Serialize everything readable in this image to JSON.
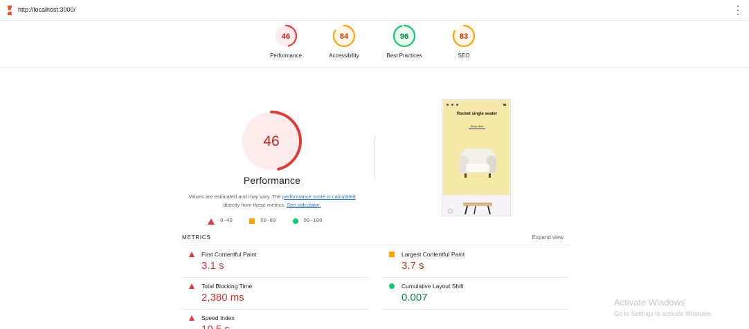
{
  "url": "http://localhost:3000/",
  "colors": {
    "fail": "#d93025",
    "average": "#c33300",
    "pass": "#018642",
    "fail_ring": "#e53935",
    "average_ring": "#ffa400",
    "pass_ring": "#0cce6b"
  },
  "gauges": [
    {
      "score": "46",
      "label": "Performance",
      "status": "fail"
    },
    {
      "score": "84",
      "label": "Accessibility",
      "status": "average"
    },
    {
      "score": "96",
      "label": "Best Practices",
      "status": "pass"
    },
    {
      "score": "83",
      "label": "SEO",
      "status": "average"
    }
  ],
  "performance": {
    "score": "46",
    "title": "Performance",
    "desc_prefix": "Values are estimated and may vary. The ",
    "desc_link1": "performance score is calculated",
    "desc_middle": " directly from these metrics. ",
    "desc_link2": "See calculator."
  },
  "legend": [
    {
      "icon": "triangle-icon",
      "range": "0–49"
    },
    {
      "icon": "square-icon",
      "range": "50–89"
    },
    {
      "icon": "circle-icon",
      "range": "90–100"
    }
  ],
  "preview": {
    "heading": "Rocket single seater",
    "link": "Shop Now"
  },
  "metrics": {
    "title": "METRICS",
    "expand": "Expand view",
    "items": [
      {
        "label": "First Contentful Paint",
        "value": "3.1 s",
        "status": "fail"
      },
      {
        "label": "Largest Contentful Paint",
        "value": "3.7 s",
        "status": "average"
      },
      {
        "label": "Total Blocking Time",
        "value": "2,380 ms",
        "status": "fail"
      },
      {
        "label": "Cumulative Layout Shift",
        "value": "0.007",
        "status": "pass"
      },
      {
        "label": "Speed Index",
        "value": "10.5 s",
        "status": "fail"
      }
    ]
  },
  "watermark": {
    "line1": "Activate Windows",
    "line2": "Go to Settings to activate Windows."
  }
}
